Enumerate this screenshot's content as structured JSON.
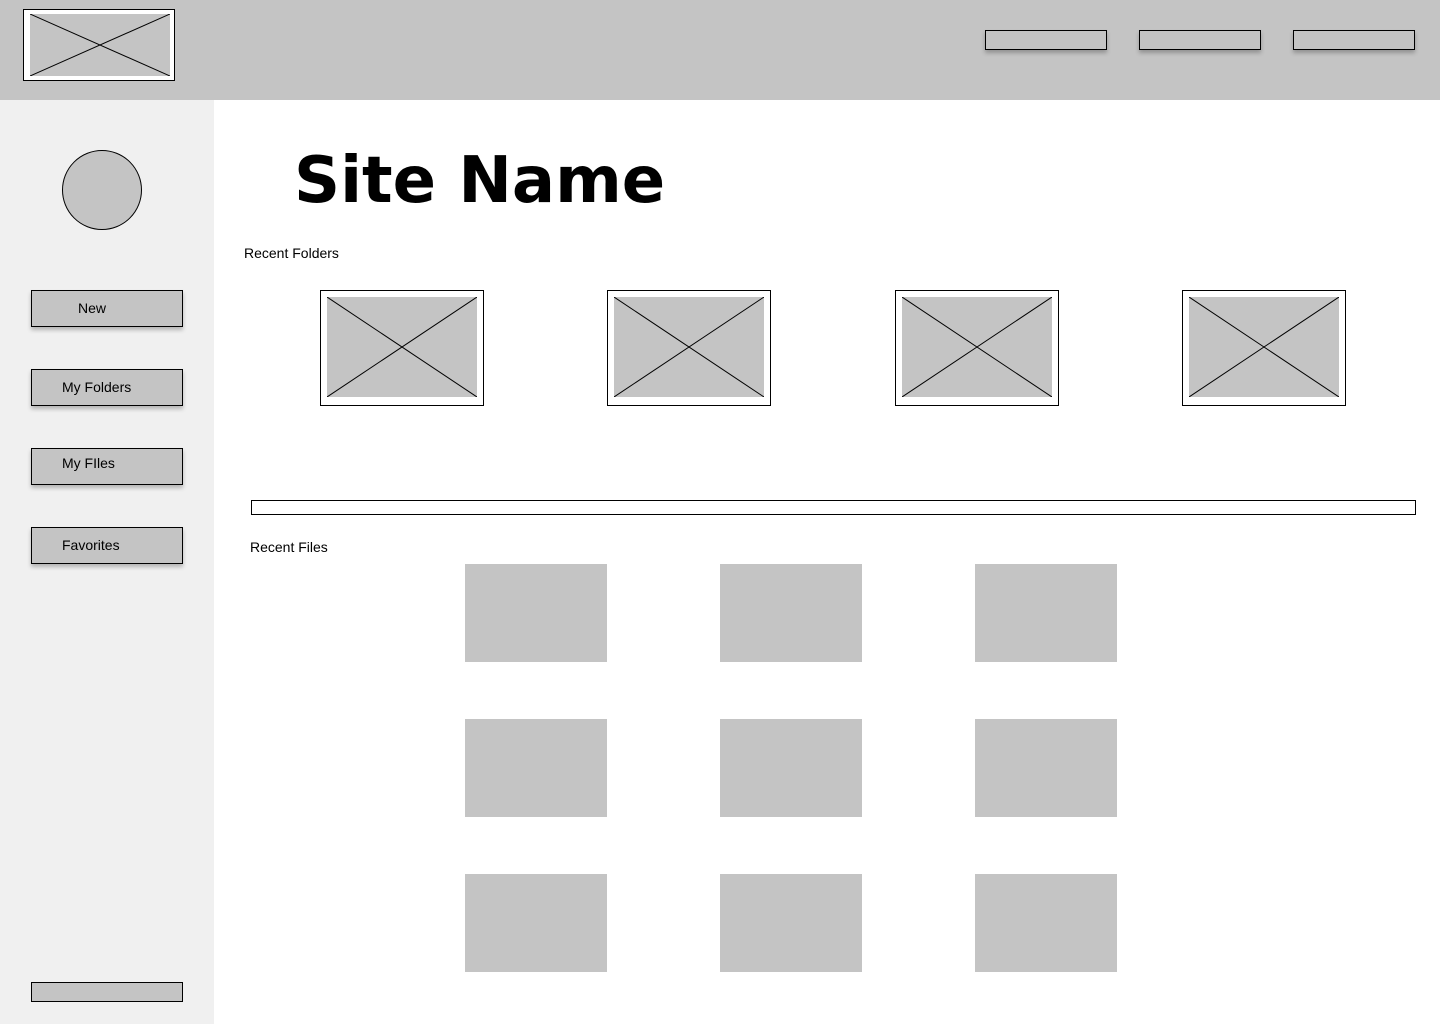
{
  "header": {
    "logo": "image-placeholder",
    "nav_buttons": [
      "",
      "",
      ""
    ]
  },
  "sidebar": {
    "avatar": "avatar-placeholder",
    "items": [
      {
        "label": "New"
      },
      {
        "label": "My Folders"
      },
      {
        "label": "My FIles"
      },
      {
        "label": "Favorites"
      }
    ],
    "bottom_button": ""
  },
  "main": {
    "site_name": "Site Name",
    "recent_folders_label": "Recent Folders",
    "recent_files_label": "Recent Files",
    "folder_count": 4,
    "file_count": 9
  },
  "colors": {
    "header_bg": "#c4c4c4",
    "sidebar_bg": "#f0f0f0",
    "placeholder": "#c4c4c4"
  }
}
